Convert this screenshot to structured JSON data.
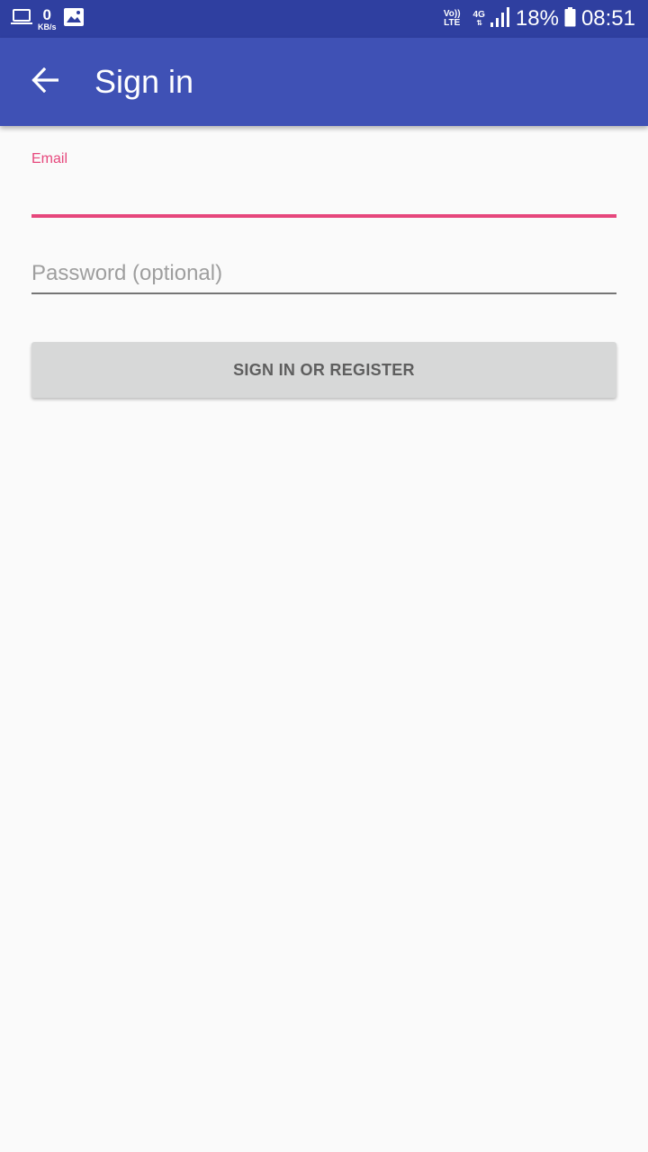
{
  "status_bar": {
    "net_speed_value": "0",
    "net_speed_unit": "KB/s",
    "volte_top": "Vo))",
    "volte_bottom": "LTE",
    "network_type": "4G",
    "network_arrows": "⇅",
    "battery_percent": "18%",
    "time": "08:51",
    "icons": [
      "laptop-icon",
      "image-icon",
      "signal-icon",
      "battery-icon"
    ]
  },
  "app_bar": {
    "title": "Sign in",
    "back_icon": "arrow-back-icon",
    "background_color": "#3f51b5"
  },
  "form": {
    "email_label": "Email",
    "email_value": "",
    "password_placeholder": "Password (optional)",
    "password_value": "",
    "submit_label": "SIGN IN OR REGISTER",
    "accent_color": "#e6477c"
  }
}
